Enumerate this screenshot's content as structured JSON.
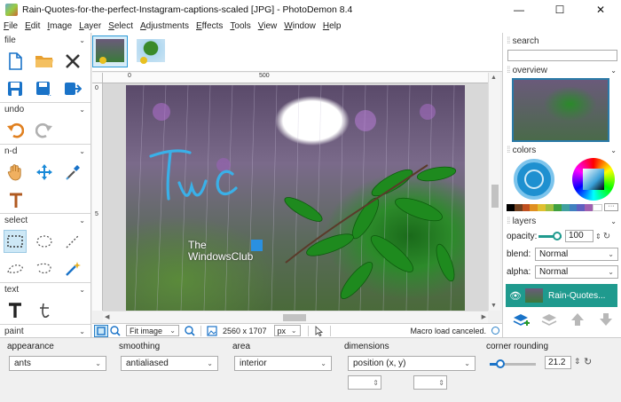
{
  "window": {
    "title": "Rain-Quotes-for-the-perfect-Instagram-captions-scaled [JPG]  -  PhotoDemon 8.4"
  },
  "menu": [
    "File",
    "Edit",
    "Image",
    "Layer",
    "Select",
    "Adjustments",
    "Effects",
    "Tools",
    "View",
    "Window",
    "Help"
  ],
  "tools": {
    "file": "file",
    "undo": "undo",
    "nd": "n-d",
    "select": "select",
    "text": "text",
    "paint": "paint"
  },
  "ruler": {
    "h0": "0",
    "h500": "500",
    "v0": "0",
    "v5": "5"
  },
  "status": {
    "zoom": "Fit image",
    "size": "2560 x 1707",
    "unit": "px",
    "message": "Macro load canceled."
  },
  "right": {
    "search": "search",
    "overview": "overview",
    "colors": "colors",
    "layers": "layers",
    "opacity_label": "opacity:",
    "opacity_value": "100",
    "blend_label": "blend:",
    "blend_value": "Normal",
    "alpha_label": "alpha:",
    "alpha_value": "Normal",
    "layer_name": "Rain-Quotes..."
  },
  "options": {
    "appearance_label": "appearance",
    "appearance_value": "ants",
    "smoothing_label": "smoothing",
    "smoothing_value": "antialiased",
    "area_label": "area",
    "area_value": "interior",
    "dimensions_label": "dimensions",
    "dimensions_value": "position (x, y)",
    "rounding_label": "corner rounding",
    "rounding_value": "21.2"
  },
  "watermark": {
    "line1": "The",
    "line2": "WindowsClub",
    "drawn_text": "Twc"
  },
  "colors": {
    "accent": "#1f9a8e",
    "selection": "#cde8f6",
    "primary_swatch": "#1e90d0"
  }
}
